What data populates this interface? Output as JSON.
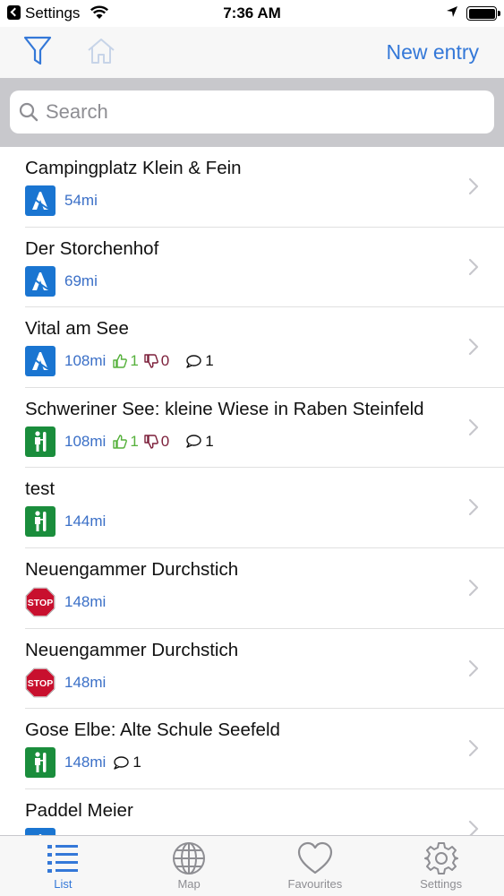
{
  "status_bar": {
    "app": "Settings",
    "time": "7:36 AM"
  },
  "nav": {
    "new_entry_label": "New entry"
  },
  "search": {
    "placeholder": "Search"
  },
  "items": [
    {
      "title": "Campingplatz Klein & Fein",
      "category": "blue-tent",
      "distance": "54mi"
    },
    {
      "title": "Der Storchenhof",
      "category": "blue-tent",
      "distance": "69mi"
    },
    {
      "title": "Vital am See",
      "category": "blue-tent",
      "distance": "108mi",
      "likes": "1",
      "dislikes": "0",
      "comments": "1"
    },
    {
      "title": "Schweriner See: kleine Wiese in Raben Steinfeld",
      "category": "green-paddler",
      "distance": "108mi",
      "likes": "1",
      "dislikes": "0",
      "comments": "1"
    },
    {
      "title": "test",
      "category": "green-paddler",
      "distance": "144mi"
    },
    {
      "title": "Neuengammer Durchstich",
      "category": "stop",
      "distance": "148mi"
    },
    {
      "title": "Neuengammer Durchstich",
      "category": "stop",
      "distance": "148mi"
    },
    {
      "title": "Gose Elbe: Alte Schule Seefeld",
      "category": "green-paddler",
      "distance": "148mi",
      "comments": "1"
    },
    {
      "title": "Paddel Meier",
      "category": "blue-tent",
      "distance": ""
    }
  ],
  "tabs": [
    {
      "label": "List",
      "icon": "list-icon",
      "active": true
    },
    {
      "label": "Map",
      "icon": "globe-icon",
      "active": false
    },
    {
      "label": "Favourites",
      "icon": "heart-icon",
      "active": false
    },
    {
      "label": "Settings",
      "icon": "gear-icon",
      "active": false
    }
  ],
  "colors": {
    "accent": "#3478d8",
    "distance": "#3a6fc7",
    "like": "#56b13c",
    "dislike": "#7c1f3a",
    "category_blue": "#1a75d1",
    "category_green": "#1a8d3c",
    "stop_red": "#c8102e"
  },
  "stop_sign_text": "STOP"
}
